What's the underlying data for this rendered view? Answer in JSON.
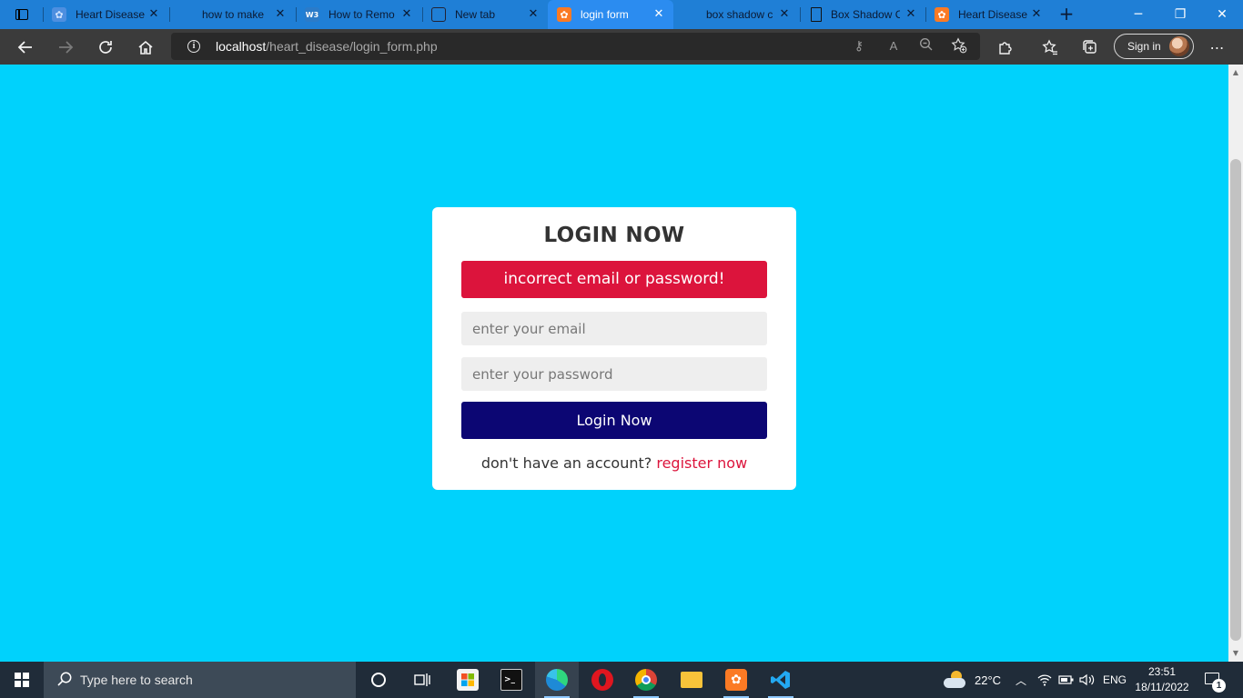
{
  "browser": {
    "tabs": [
      {
        "title": "Heart Disease",
        "icon": "xampp-icon",
        "active": false
      },
      {
        "title": "how to make",
        "icon": "edge-icon",
        "active": false
      },
      {
        "title": "How to Remo",
        "icon": "w3schools-icon",
        "active": false
      },
      {
        "title": "New tab",
        "icon": "new-tab-icon",
        "active": false
      },
      {
        "title": "login form",
        "icon": "xampp-icon",
        "active": true
      },
      {
        "title": "box shadow c",
        "icon": "edge-icon",
        "active": false
      },
      {
        "title": "Box Shadow C",
        "icon": "document-icon",
        "active": false
      },
      {
        "title": "Heart Disease",
        "icon": "xampp-icon",
        "active": false
      }
    ],
    "url_host": "localhost",
    "url_path": "/heart_disease/login_form.php",
    "sign_in_label": "Sign in"
  },
  "login": {
    "heading": "LOGIN NOW",
    "error_message": "incorrect email or password!",
    "email_placeholder": "enter your email",
    "password_placeholder": "enter your password",
    "submit_label": "Login Now",
    "register_prompt": "don't have an account?",
    "register_link": "register now"
  },
  "taskbar": {
    "search_placeholder": "Type here to search",
    "weather": "22°C",
    "language": "ENG",
    "time": "23:51",
    "date": "18/11/2022",
    "notification_count": "1"
  },
  "colors": {
    "page_background": "#00d2fc",
    "alert": "#dc143c",
    "button": "#0c0673",
    "link": "#dc143c"
  }
}
